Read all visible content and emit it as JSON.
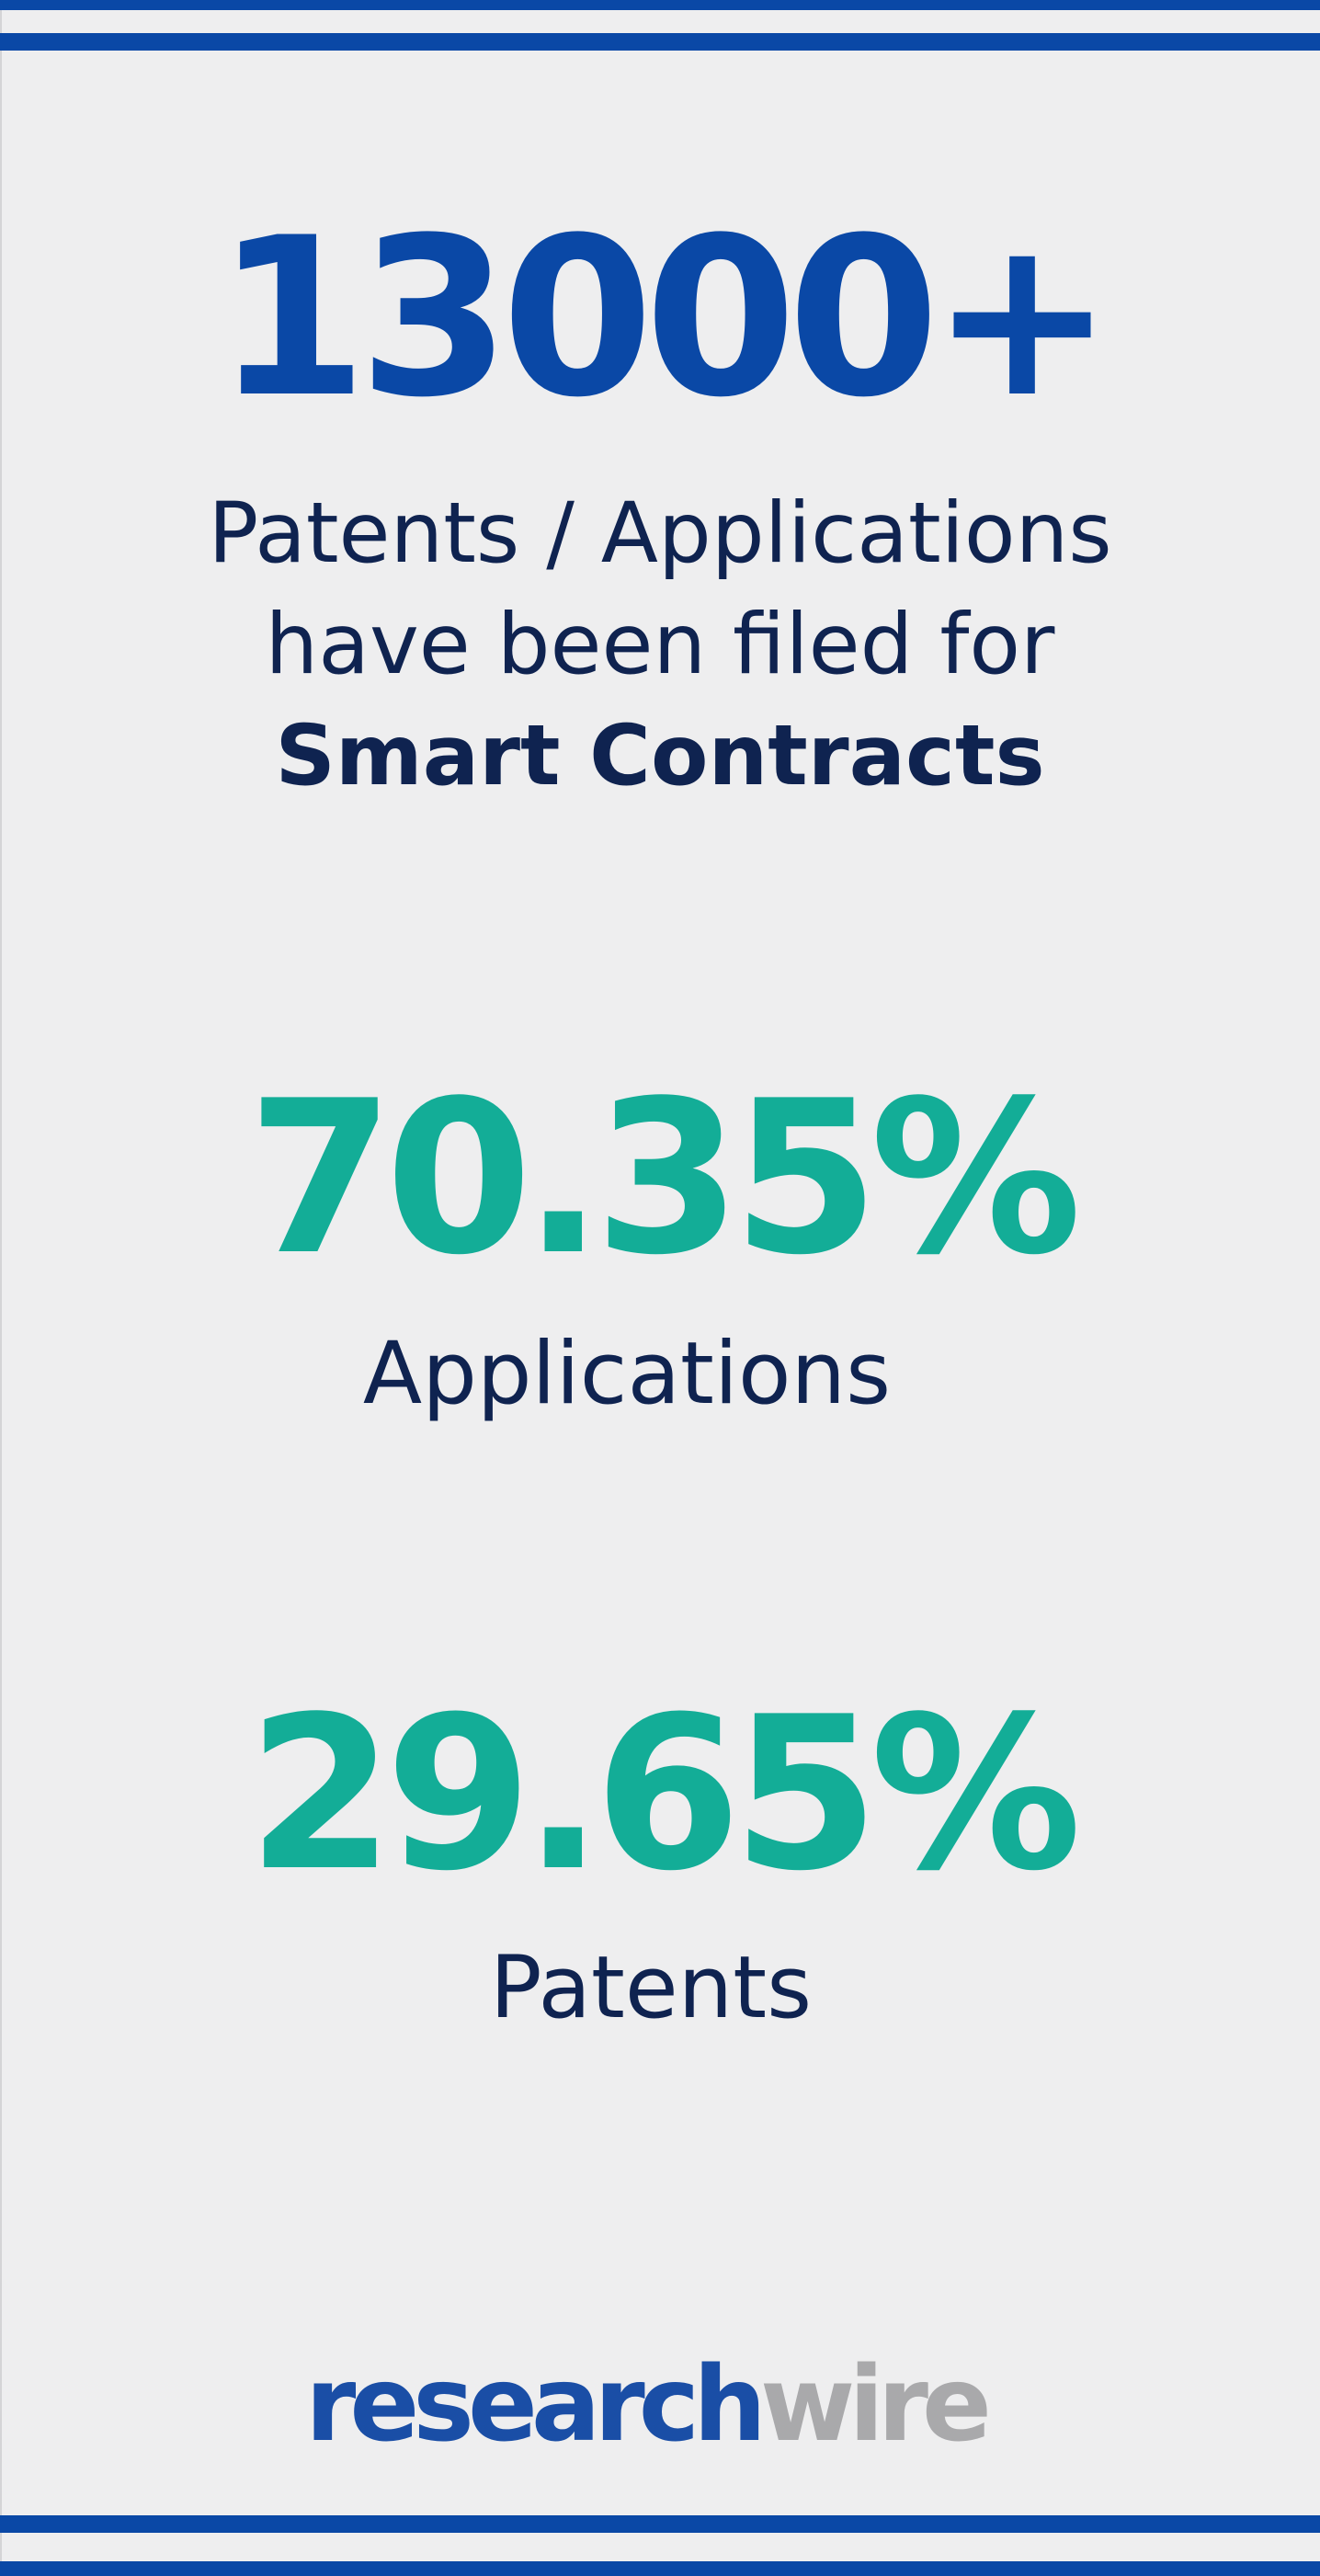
{
  "headline": {
    "value": "13000+"
  },
  "description": {
    "line1": "Patents / Applications",
    "line2": "have been filed for",
    "line3": "Smart Contracts"
  },
  "stats": [
    {
      "value": "70.35%",
      "label": "Applications"
    },
    {
      "value": "29.65%",
      "label": "Patents"
    }
  ],
  "logo": {
    "part1": "research",
    "part2": "wire"
  },
  "colors": {
    "band_blue": "#0a48a6",
    "headline_blue": "#0a48a6",
    "teal": "#13ad97",
    "dark_navy": "#0f2350",
    "logo_grey": "#a9a9ab",
    "background": "#eeeeef"
  }
}
